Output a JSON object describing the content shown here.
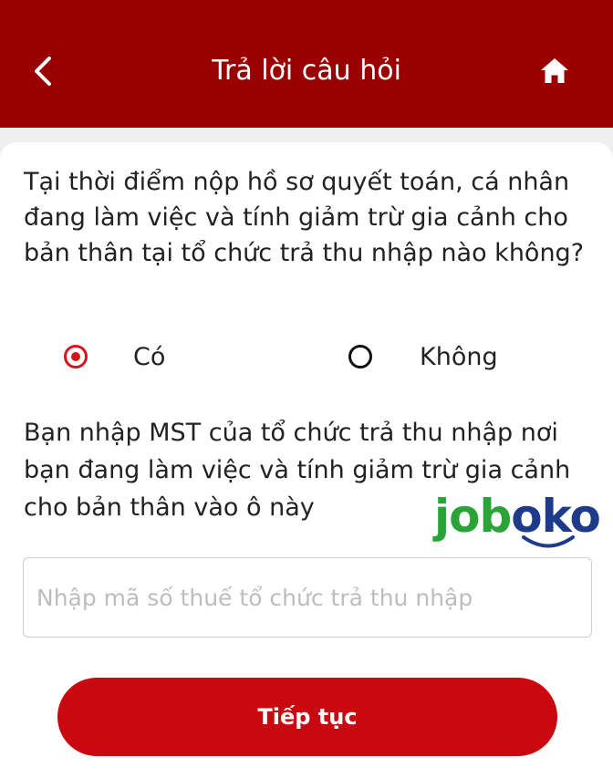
{
  "header": {
    "title": "Trả lời câu hỏi",
    "back_icon": "chevron-left-icon",
    "home_icon": "home-icon",
    "background_color": "#9b0000"
  },
  "question": {
    "text": "Tại thời điểm nộp hồ sơ quyết toán, cá nhân đang làm việc và tính giảm trừ gia cảnh cho bản thân tại tổ chức trả thu nhập nào không?",
    "options": [
      {
        "label": "Có",
        "selected": true
      },
      {
        "label": "Không",
        "selected": false
      }
    ]
  },
  "mst": {
    "label": "Bạn nhập MST của tổ chức trả thu nhập nơi bạn đang làm việc và tính giảm trừ gia cảnh cho bản thân vào ô này",
    "input_value": "",
    "input_placeholder": "Nhập mã số thuế tổ chức trả thu nhập"
  },
  "watermark": {
    "text": "joboko"
  },
  "continue_button": {
    "label": "Tiếp tục",
    "color": "#c9080f"
  }
}
